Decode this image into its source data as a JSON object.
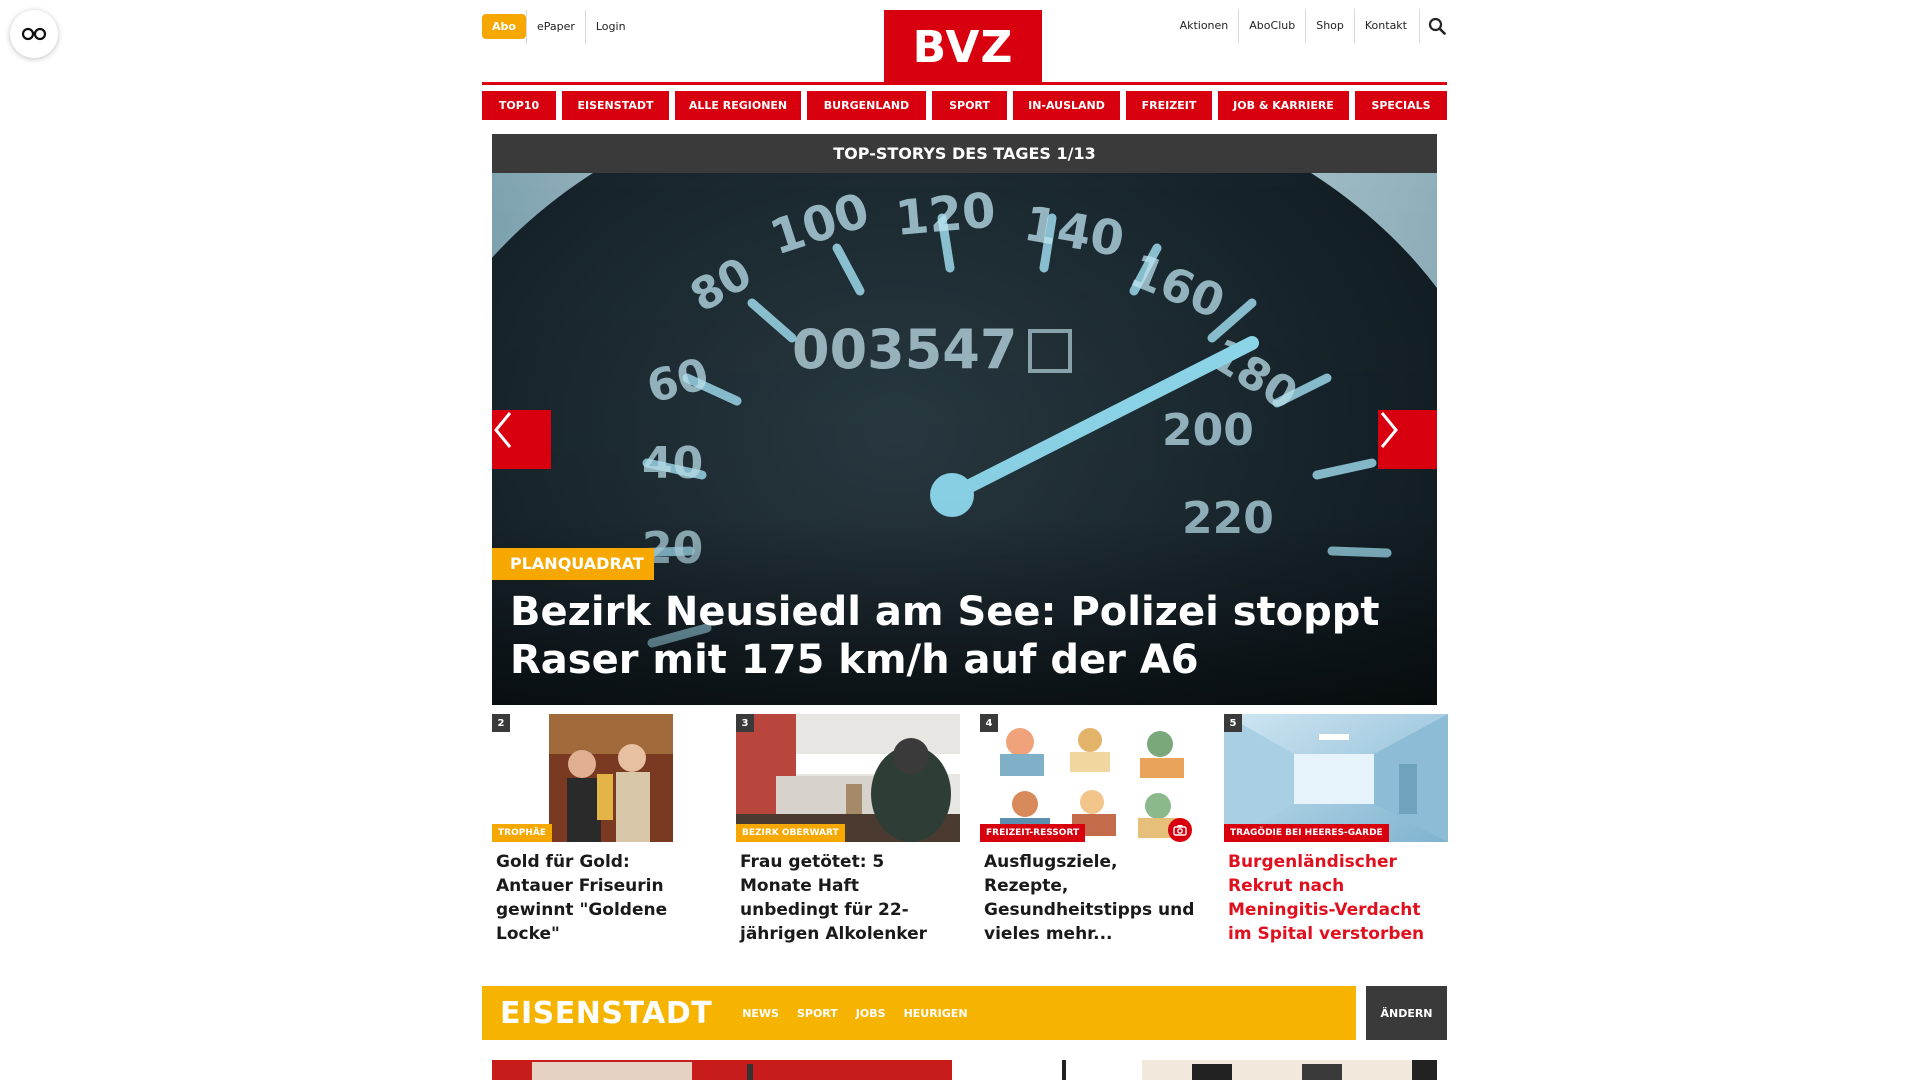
{
  "header": {
    "abo_label": "Abo",
    "left_links": [
      "ePaper",
      "Login"
    ],
    "logo_text": "BVZ",
    "right_links": [
      "Aktionen",
      "AboClub",
      "Shop",
      "Kontakt"
    ]
  },
  "nav": {
    "items": [
      "TOP10",
      "EISENSTADT",
      "ALLE REGIONEN",
      "BURGENLAND",
      "SPORT",
      "IN-AUSLAND",
      "FREIZEIT",
      "JOB & KARRIERE",
      "SPECIALS"
    ]
  },
  "hero": {
    "bar_title": "TOP-STORYS DES TAGES 1/13",
    "tag": "PLANQUADRAT",
    "title": "Bezirk Neusiedl am See: Polizei stoppt Raser mit 175 km/h auf der A6",
    "speedo_readout": "003547",
    "speedo_marks": [
      "100",
      "120",
      "140",
      "160",
      "180",
      "200",
      "220",
      "80",
      "60",
      "40",
      "20"
    ]
  },
  "teasers": [
    {
      "num": "2",
      "tag": "TROPHÄE",
      "tag_color": "#f6a800",
      "title": "Gold für Gold: Antauer Friseurin gewinnt \"Goldene Locke\"",
      "title_red": false
    },
    {
      "num": "3",
      "tag": "BEZIRK OBERWART",
      "tag_color": "#f6a800",
      "title": "Frau getötet: 5 Monate Haft unbedingt für 22-jährigen Alkolenker",
      "title_red": false
    },
    {
      "num": "4",
      "tag": "FREIZEIT-RESSORT",
      "tag_color": "#d8000f",
      "title": "Ausflugsziele, Rezepte, Gesundheitstipps und vieles mehr...",
      "title_red": false
    },
    {
      "num": "5",
      "tag": "TRAGÖDIE BEI HEERES-GARDE",
      "tag_color": "#d8000f",
      "title": "Burgenländischer Rekrut nach Meningitis-Verdacht im Spital verstorben",
      "title_red": true
    }
  ],
  "region": {
    "title": "EISENSTADT",
    "links": [
      "NEWS",
      "SPORT",
      "JOBS",
      "HEURIGEN"
    ],
    "change_label": "ÄNDERN"
  },
  "colors": {
    "brand_red": "#d8000f",
    "accent_yellow": "#f6a800",
    "dark_bar": "#3a3a3a"
  }
}
